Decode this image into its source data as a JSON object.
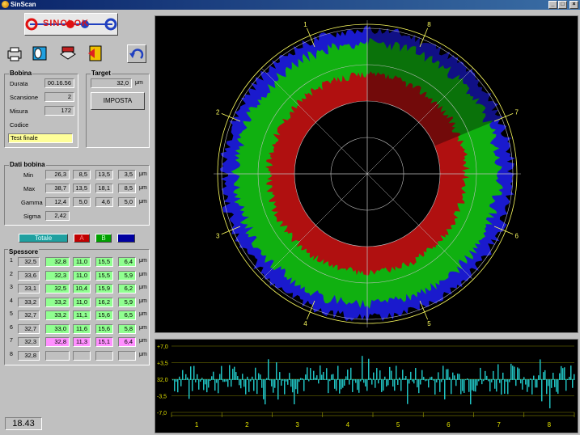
{
  "window": {
    "title": "SinScan",
    "min": "_",
    "max": "□",
    "close": "×"
  },
  "logo": {
    "text": "SINOLOK"
  },
  "toolbar": {
    "icons": [
      "printer-icon",
      "roll-icon",
      "stack-icon",
      "exit-icon"
    ],
    "undo": "undo-icon"
  },
  "bobina": {
    "title": "Bobina",
    "durata_label": "Durata",
    "durata": "00.16.56",
    "scansione_label": "Scansione",
    "scansione": "2",
    "misura_label": "Misura",
    "misura": "172",
    "codice_label": "Codice",
    "codice": "Test finale"
  },
  "target": {
    "title": "Target",
    "value": "32,0",
    "unit": "μm",
    "button": "IMPOSTA"
  },
  "dati": {
    "title": "Dati bobina",
    "rows": [
      {
        "label": "Min",
        "v": [
          "26,3",
          "8,5",
          "13,5",
          "3,5"
        ],
        "unit": "μm"
      },
      {
        "label": "Max",
        "v": [
          "38,7",
          "13,5",
          "18,1",
          "8,5"
        ],
        "unit": "μm"
      },
      {
        "label": "Gamma",
        "v": [
          "12,4",
          "5,0",
          "4,6",
          "5,0"
        ],
        "unit": "μm"
      }
    ],
    "sigma_label": "Sigma",
    "sigma": "2,42"
  },
  "legend": {
    "total": "Totale",
    "a": "A",
    "b": "B",
    "c": ""
  },
  "spessore": {
    "title": "Spessore",
    "rows": [
      {
        "idx": "1",
        "t": "32,5",
        "a": "32,8",
        "b": "11,0",
        "c": "15,5",
        "d": "6,4",
        "unit": "μm",
        "hl": "green"
      },
      {
        "idx": "2",
        "t": "33,6",
        "a": "32,3",
        "b": "11,0",
        "c": "15,5",
        "d": "5,9",
        "unit": "μm",
        "hl": "green"
      },
      {
        "idx": "3",
        "t": "33,1",
        "a": "32,5",
        "b": "10,4",
        "c": "15,9",
        "d": "6,2",
        "unit": "μm",
        "hl": "green"
      },
      {
        "idx": "4",
        "t": "33,2",
        "a": "33,2",
        "b": "11,0",
        "c": "16,2",
        "d": "5,9",
        "unit": "μm",
        "hl": "green"
      },
      {
        "idx": "5",
        "t": "32,7",
        "a": "33,2",
        "b": "11,1",
        "c": "15,6",
        "d": "6,5",
        "unit": "μm",
        "hl": "green"
      },
      {
        "idx": "6",
        "t": "32,7",
        "a": "33,0",
        "b": "11,6",
        "c": "15,6",
        "d": "5,8",
        "unit": "μm",
        "hl": "green"
      },
      {
        "idx": "7",
        "t": "32,3",
        "a": "32,8",
        "b": "11,3",
        "c": "15,1",
        "d": "6,4",
        "unit": "μm",
        "hl": "pink"
      },
      {
        "idx": "8",
        "t": "32,8",
        "a": "",
        "b": "",
        "c": "",
        "d": "",
        "unit": "μm",
        "hl": "none"
      }
    ]
  },
  "clock": "18.43",
  "polar": {
    "sector_labels": [
      "1",
      "8",
      "7",
      "6",
      "5",
      "4",
      "3",
      "2"
    ],
    "colors": {
      "outer": "#1a1acd",
      "mid": "#10b010",
      "inner": "#b01010",
      "axis": "#ffff60",
      "grid": "#c0c0c0"
    },
    "highlight_sector": "8"
  },
  "strip": {
    "y_ticks": [
      "+7,0",
      "+3,5",
      "32,0",
      "-3,5",
      "-7,0"
    ],
    "x_ticks": [
      "1",
      "2",
      "3",
      "4",
      "5",
      "6",
      "7",
      "8"
    ],
    "bar_color": "#20c0c0"
  }
}
